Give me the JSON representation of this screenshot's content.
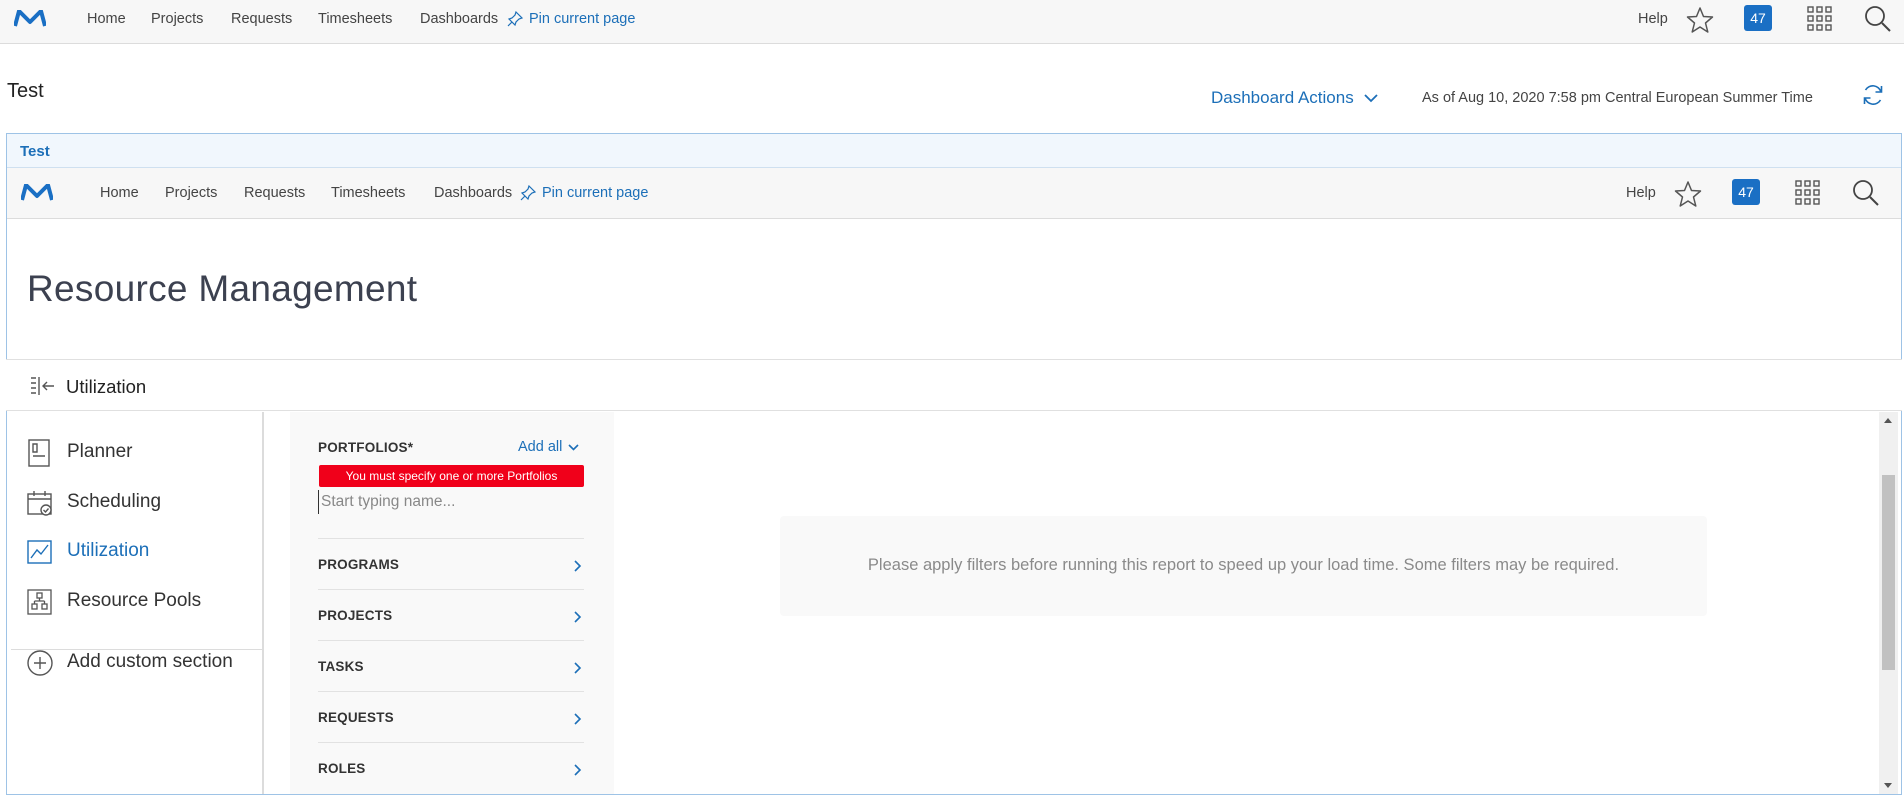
{
  "top_nav": {
    "links": [
      "Home",
      "Projects",
      "Requests",
      "Timesheets",
      "Dashboards"
    ],
    "pin_label": "Pin current page",
    "help_label": "Help",
    "notification_count": "47"
  },
  "dashboard": {
    "title": "Test",
    "actions_label": "Dashboard Actions",
    "as_of": "As of  Aug 10, 2020 7:58 pm Central European Summer Time"
  },
  "portlet": {
    "title": "Test",
    "nav": {
      "links": [
        "Home",
        "Projects",
        "Requests",
        "Timesheets",
        "Dashboards"
      ],
      "pin_label": "Pin current page",
      "help_label": "Help",
      "notification_count": "47"
    },
    "page_title": "Resource Management",
    "section_title": "Utilization",
    "menu": [
      {
        "label": "Planner",
        "icon": "planner-icon"
      },
      {
        "label": "Scheduling",
        "icon": "calendar-check-icon"
      },
      {
        "label": "Utilization",
        "icon": "chart-line-icon"
      },
      {
        "label": "Resource Pools",
        "icon": "org-chart-icon"
      },
      {
        "label": "Add custom section",
        "icon": "plus-circle-icon"
      }
    ],
    "filters": {
      "portfolios_label": "PORTFOLIOS*",
      "add_all_label": "Add all",
      "error": "You must specify one or more Portfolios",
      "name_placeholder": "Start typing name...",
      "groups": [
        "PROGRAMS",
        "PROJECTS",
        "TASKS",
        "REQUESTS",
        "ROLES"
      ]
    },
    "message": "Please apply filters before running this report to speed up your load time. Some filters may be required."
  },
  "colors": {
    "accent": "#1c6fb8",
    "badge": "#1a6fc4",
    "error": "#f0001a"
  }
}
